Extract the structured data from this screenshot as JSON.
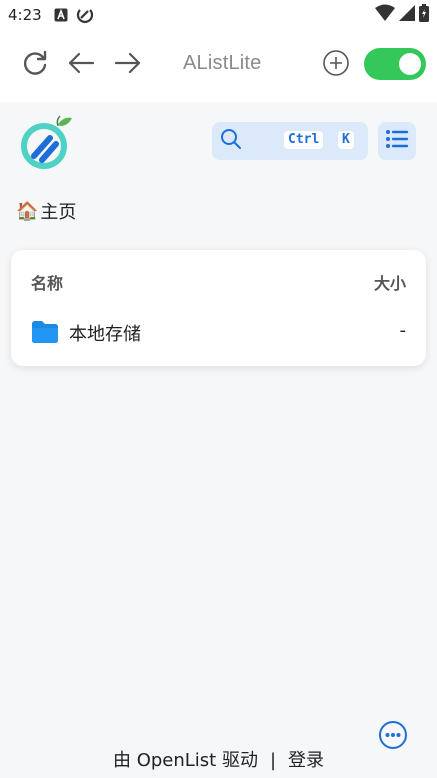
{
  "status_bar": {
    "time": "4:23",
    "icons": [
      "app-a-icon",
      "sync-icon",
      "wifi-icon",
      "signal-icon",
      "battery-icon"
    ]
  },
  "top_bar": {
    "title": "AListLite",
    "icons": [
      "refresh-icon",
      "back-arrow-icon",
      "forward-arrow-icon",
      "add-circle-icon"
    ],
    "toggle_on": true,
    "accent": "#34c759"
  },
  "header": {
    "search_shortcut": {
      "key1": "Ctrl",
      "key2": "K"
    },
    "accent": "#1e6ed8",
    "button_bg": "#dbe9fb"
  },
  "breadcrumb": {
    "home_icon": "🏠",
    "label": "主页"
  },
  "file_list": {
    "columns": {
      "name": "名称",
      "size": "大小"
    },
    "rows": [
      {
        "name": "本地存储",
        "size": "-",
        "icon": "folder-icon"
      }
    ]
  },
  "footer": {
    "powered_by": "由 OpenList 驱动",
    "separator": "|",
    "login": "登录"
  }
}
